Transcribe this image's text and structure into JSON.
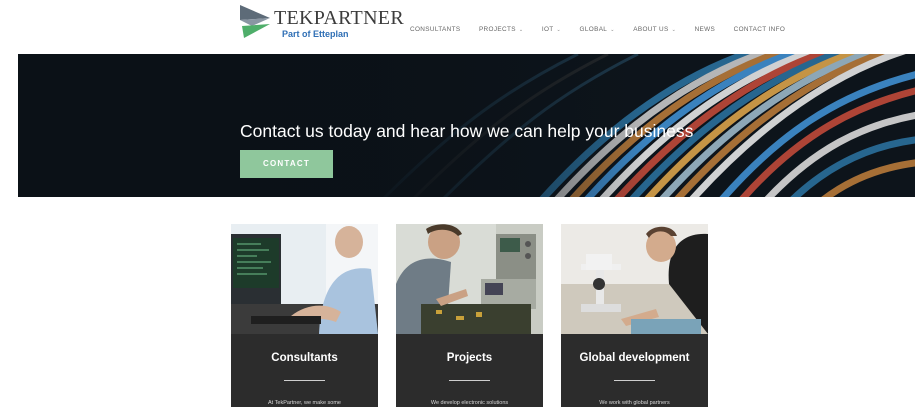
{
  "header": {
    "logo": {
      "title": "TEKPARTNER",
      "subtitle": "Part of Etteplan"
    },
    "nav": [
      {
        "label": "CONSULTANTS",
        "dropdown": false
      },
      {
        "label": "PROJECTS",
        "dropdown": true
      },
      {
        "label": "IOT",
        "dropdown": true
      },
      {
        "label": "GLOBAL",
        "dropdown": true
      },
      {
        "label": "ABOUT US",
        "dropdown": true
      },
      {
        "label": "NEWS",
        "dropdown": false
      },
      {
        "label": "CONTACT INFO",
        "dropdown": false
      }
    ],
    "dropdown_icon": "chevron-down-icon"
  },
  "hero": {
    "heading": "Contact us today and hear how we can help your business",
    "cta_label": "CONTACT",
    "cta_color": "#8fc79c"
  },
  "cards": [
    {
      "title": "Consultants",
      "text": "At TekPartner, we make some"
    },
    {
      "title": "Projects",
      "text": "We develop electronic solutions"
    },
    {
      "title": "Global development",
      "text": "We work with global partners"
    }
  ],
  "colors": {
    "card_bg": "#2c2c2c",
    "hero_bg": "#0b1117",
    "logo_blue": "#2f6fb5",
    "logo_green": "#4fae6a"
  }
}
